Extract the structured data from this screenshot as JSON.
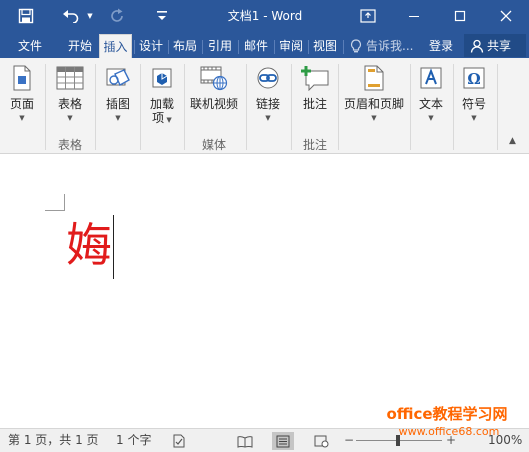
{
  "window": {
    "title": "文档1 - Word",
    "accent": "#2b579a"
  },
  "quick_access": {
    "save_icon": "save-icon",
    "undo_icon": "undo-icon",
    "redo_icon": "redo-icon",
    "customize_icon": "customize-arrow-icon"
  },
  "tabs": [
    {
      "label": "文件"
    },
    {
      "label": "开始"
    },
    {
      "label": "插入",
      "active": true
    },
    {
      "label": "设计"
    },
    {
      "label": "布局"
    },
    {
      "label": "引用"
    },
    {
      "label": "邮件"
    },
    {
      "label": "审阅"
    },
    {
      "label": "视图"
    }
  ],
  "tell_me": "告诉我...",
  "login": "登录",
  "share": "共享",
  "ribbon": {
    "buttons": [
      {
        "label": "页面",
        "icon": "pages-icon"
      },
      {
        "label": "表格",
        "icon": "table-icon"
      },
      {
        "label": "插图",
        "icon": "illustrations-icon"
      },
      {
        "label": "加载",
        "label2": "项",
        "icon": "addins-icon"
      },
      {
        "label": "联机视频",
        "icon": "online-video-icon"
      },
      {
        "label": "链接",
        "icon": "link-icon"
      },
      {
        "label": "批注",
        "icon": "comment-icon"
      },
      {
        "label": "页眉和页脚",
        "icon": "header-footer-icon"
      },
      {
        "label": "文本",
        "icon": "text-icon"
      },
      {
        "label": "符号",
        "icon": "symbol-icon"
      }
    ],
    "groups": {
      "tables": "表格",
      "media": "媒体",
      "comments": "批注"
    }
  },
  "document": {
    "text": "娒",
    "text_color": "#e11b1b"
  },
  "watermark": {
    "line1": "office教程学习网",
    "line2": "www.office68.com",
    "color": "#ff6600"
  },
  "status": {
    "page": "第 1 页，共 1 页",
    "words": "1 个字",
    "zoom": "100%"
  }
}
